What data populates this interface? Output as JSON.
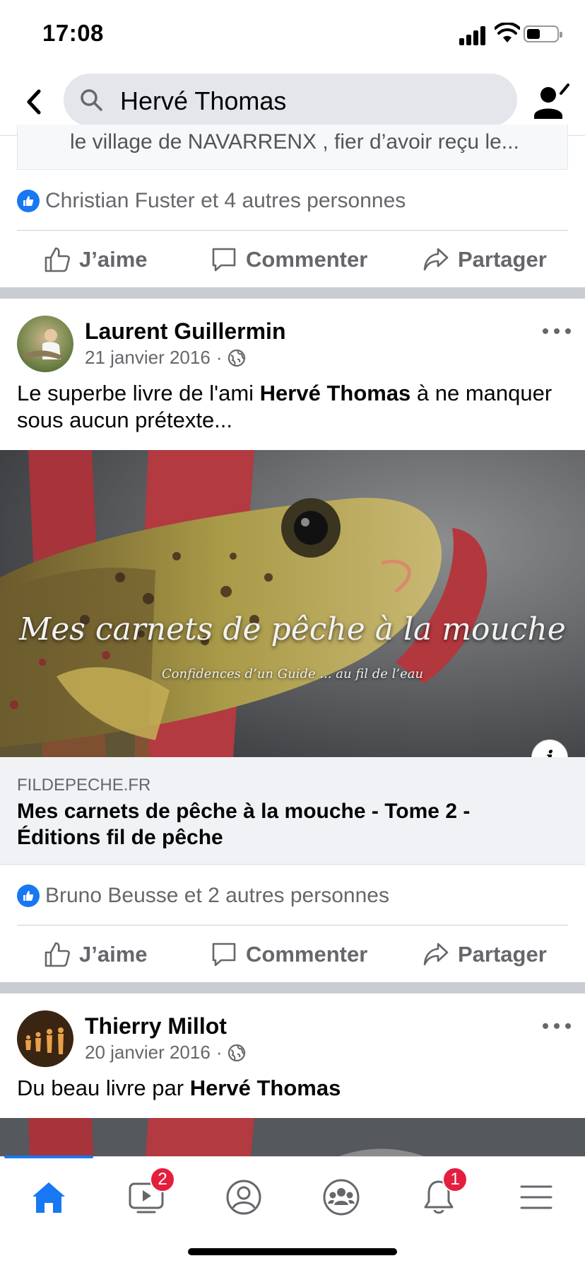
{
  "status_bar": {
    "time": "17:08"
  },
  "search": {
    "query": "Hervé Thomas"
  },
  "prev_post": {
    "shared_snippet": "le village de NAVARRENX , fier d’avoir reçu le...",
    "reactions_text": "Christian Fuster et 4 autres personnes"
  },
  "actions": {
    "like": "J’aime",
    "comment": "Commenter",
    "share": "Partager"
  },
  "post1": {
    "author": "Laurent Guillermin",
    "date": "21 janvier 2016",
    "dot": "·",
    "text_before": "Le superbe livre de l'ami ",
    "text_bold": "Hervé Thomas",
    "text_after": "  à ne manquer sous aucun prétexte...",
    "image_title": "Mes carnets de pêche à la mouche",
    "image_subtitle": "Confidences d’un Guide ... au fil de l’eau",
    "info_glyph": "i",
    "link_domain": "FILDEPECHE.FR",
    "link_title": "Mes carnets de pêche à la mouche - Tome 2 - Éditions fil de pêche",
    "reactions_text": "Bruno Beusse et 2 autres personnes"
  },
  "post2": {
    "author": "Thierry Millot",
    "date": "20 janvier 2016",
    "dot": "·",
    "text_before": "Du beau livre par ",
    "text_bold": "Hervé Thomas"
  },
  "tab_bar": {
    "tabs": [
      {
        "icon": "home-icon",
        "active": true
      },
      {
        "icon": "watch-icon",
        "badge": "2"
      },
      {
        "icon": "profile-icon"
      },
      {
        "icon": "groups-icon"
      },
      {
        "icon": "bell-icon",
        "badge": "1"
      },
      {
        "icon": "menu-icon"
      }
    ]
  },
  "colors": {
    "accent": "#1877f2",
    "badge": "#e41e3f",
    "secondary_text": "#65676b"
  }
}
